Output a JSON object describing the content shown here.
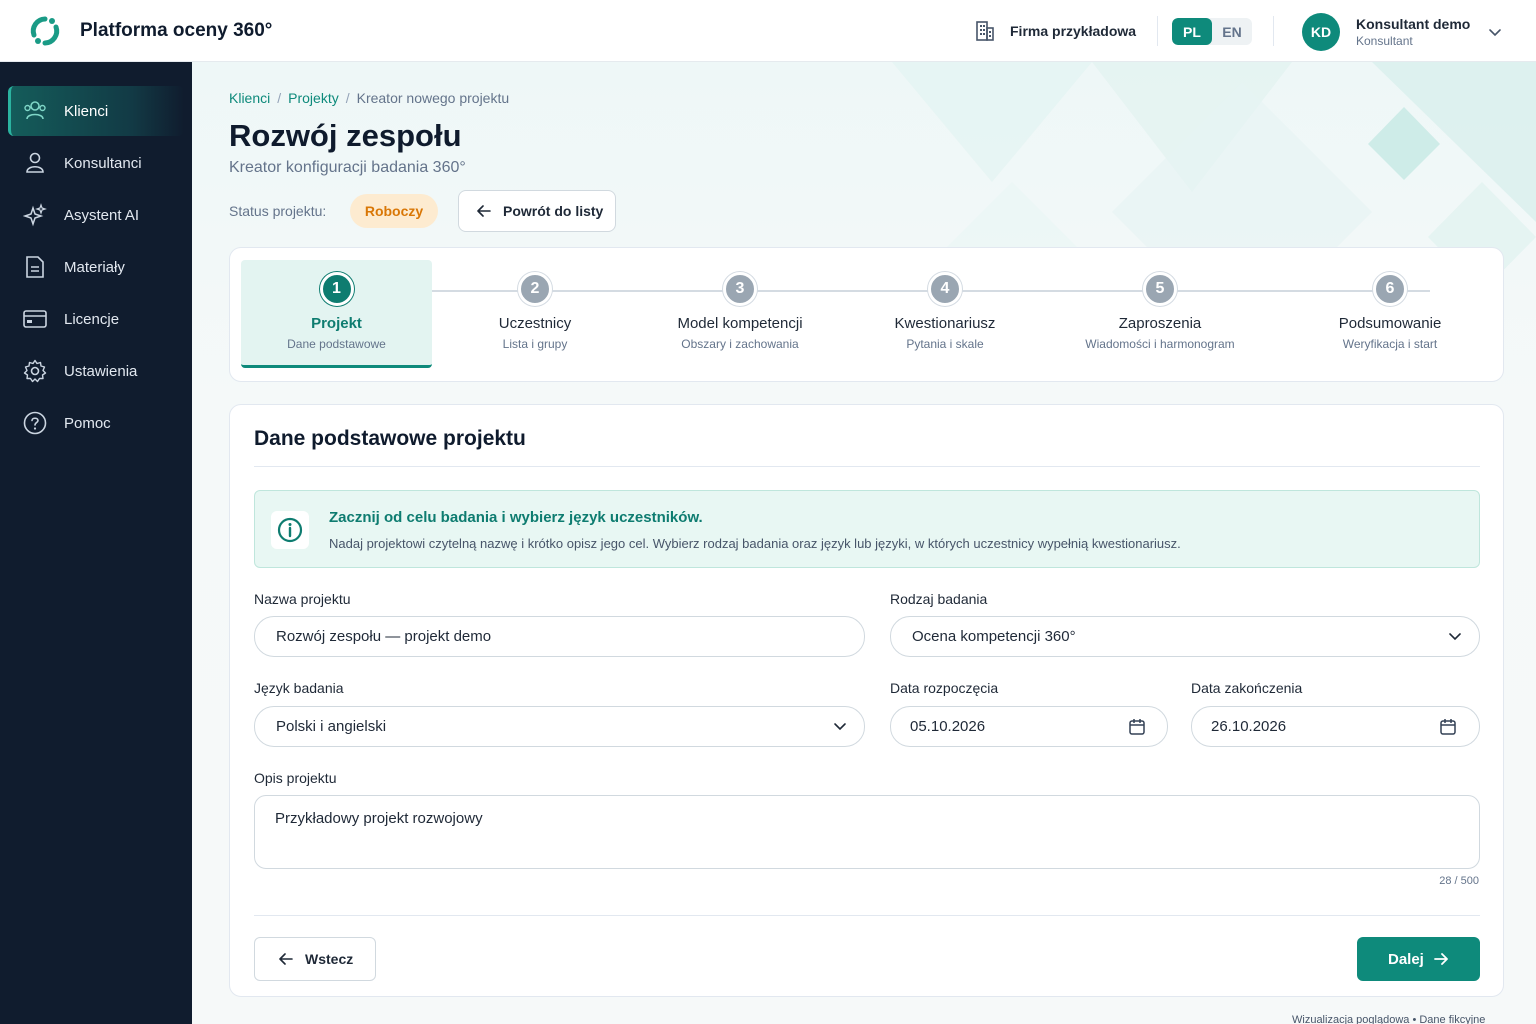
{
  "app": {
    "name": "Platforma oceny 360°"
  },
  "header": {
    "company": "Firma przykładowa",
    "languages": [
      {
        "code": "PL",
        "active": true
      },
      {
        "code": "EN",
        "active": false
      }
    ],
    "user": {
      "initials": "KD",
      "name": "Konsultant demo",
      "role": "Konsultant"
    }
  },
  "sidebar": {
    "items": [
      {
        "label": "Klienci",
        "icon": "users-icon",
        "active": true
      },
      {
        "label": "Konsultanci",
        "icon": "user-icon",
        "active": false
      },
      {
        "label": "Asystent AI",
        "icon": "sparkles-icon",
        "active": false
      },
      {
        "label": "Materiały",
        "icon": "document-icon",
        "active": false
      },
      {
        "label": "Licencje",
        "icon": "card-icon",
        "active": false
      },
      {
        "label": "Ustawienia",
        "icon": "gear-icon",
        "active": false
      },
      {
        "label": "Pomoc",
        "icon": "help-icon",
        "active": false
      }
    ]
  },
  "breadcrumb": {
    "items": [
      "Klienci",
      "Projekty"
    ],
    "current": "Kreator nowego projektu"
  },
  "page": {
    "title": "Rozwój zespołu",
    "subtitle": "Kreator konfiguracji badania 360°",
    "status_label": "Status projektu:",
    "status_value": "Roboczy",
    "back_to_list": "Powrót do listy"
  },
  "steps": [
    {
      "num": "1",
      "title": "Projekt",
      "subtitle": "Dane podstawowe",
      "active": true
    },
    {
      "num": "2",
      "title": "Uczestnicy",
      "subtitle": "Lista i grupy",
      "active": false
    },
    {
      "num": "3",
      "title": "Model kompetencji",
      "subtitle": "Obszary i zachowania",
      "active": false
    },
    {
      "num": "4",
      "title": "Kwestionariusz",
      "subtitle": "Pytania i skale",
      "active": false
    },
    {
      "num": "5",
      "title": "Zaproszenia",
      "subtitle": "Wiadomości i harmonogram",
      "active": false
    },
    {
      "num": "6",
      "title": "Podsumowanie",
      "subtitle": "Weryfikacja i start",
      "active": false
    }
  ],
  "form": {
    "title": "Dane podstawowe projektu",
    "info": {
      "title": "Zacznij od celu badania i wybierz język uczestników.",
      "text": "Nadaj projektowi czytelną nazwę i krótko opisz jego cel. Wybierz rodzaj badania oraz język lub języki, w których uczestnicy wypełnią kwestionariusz."
    },
    "project_name": {
      "label": "Nazwa projektu",
      "value": "Rozwój zespołu — projekt demo"
    },
    "study_type": {
      "label": "Rodzaj badania",
      "value": "Ocena kompetencji 360°"
    },
    "language": {
      "label": "Język badania",
      "value": "Polski i angielski"
    },
    "start_date": {
      "label": "Data rozpoczęcia",
      "value": "05.10.2026"
    },
    "end_date": {
      "label": "Data zakończenia",
      "value": "26.10.2026"
    },
    "description": {
      "label": "Opis projektu",
      "value": "Przykładowy projekt rozwojowy",
      "counter": "28 / 500"
    },
    "back_button": "Wstecz",
    "next_button": "Dalej"
  },
  "footnote": "Wizualizacja poglądowa • Dane fikcyjne",
  "colors": {
    "accent": "#0e8a7b",
    "sidebar": "#101c2e",
    "status_badge_bg": "#fdebd0",
    "status_badge_text": "#d97706"
  }
}
